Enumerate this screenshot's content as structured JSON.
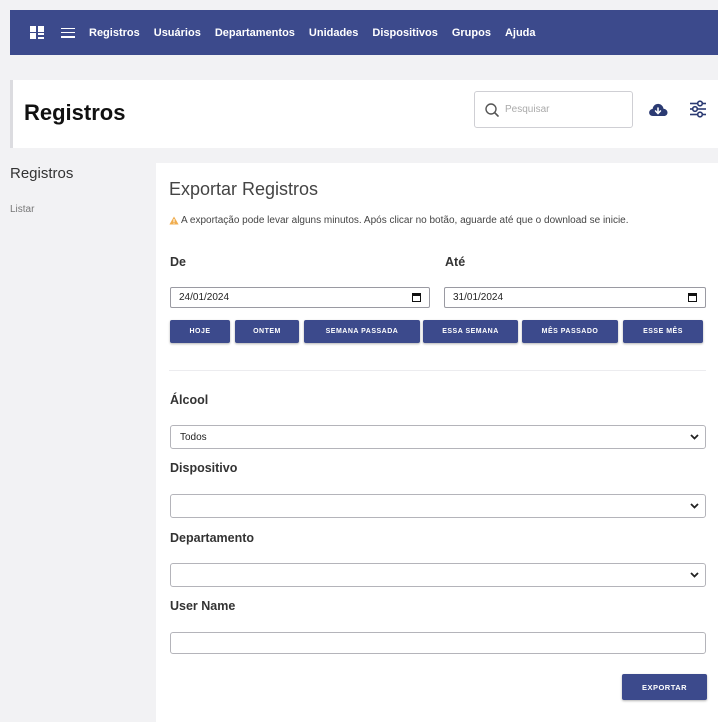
{
  "nav": {
    "items": [
      "Registros",
      "Usuários",
      "Departamentos",
      "Unidades",
      "Dispositivos",
      "Grupos",
      "Ajuda"
    ]
  },
  "header": {
    "title": "Registros",
    "search_placeholder": "Pesquisar"
  },
  "sidebar": {
    "title": "Registros",
    "links": [
      "Listar"
    ]
  },
  "export": {
    "title": "Exportar Registros",
    "warning": "A exportação pode levar alguns minutos. Após clicar no botão, aguarde até que o download se inicie.",
    "from_label": "De",
    "to_label": "Até",
    "from_value": "24/01/2024",
    "to_value": "31/01/2024",
    "quick_buttons": [
      "HOJE",
      "ONTEM",
      "SEMANA PASSADA",
      "ESSA SEMANA",
      "MÊS PASSADO",
      "ESSE MÊS"
    ],
    "alcohol_label": "Álcool",
    "alcohol_value": "Todos",
    "device_label": "Dispositivo",
    "device_value": "",
    "department_label": "Departamento",
    "department_value": "",
    "username_label": "User Name",
    "username_value": "",
    "export_button": "EXPORTAR"
  },
  "colors": {
    "primary": "#3c4a8c",
    "warning": "#f0ad4e",
    "page_bg": "#f2f2f4"
  },
  "icons": [
    "dashboard-grid-icon",
    "menu-list-icon",
    "search-icon",
    "cloud-download-icon",
    "filter-sliders-icon",
    "warning-icon",
    "calendar-icon",
    "chevron-down-icon"
  ]
}
